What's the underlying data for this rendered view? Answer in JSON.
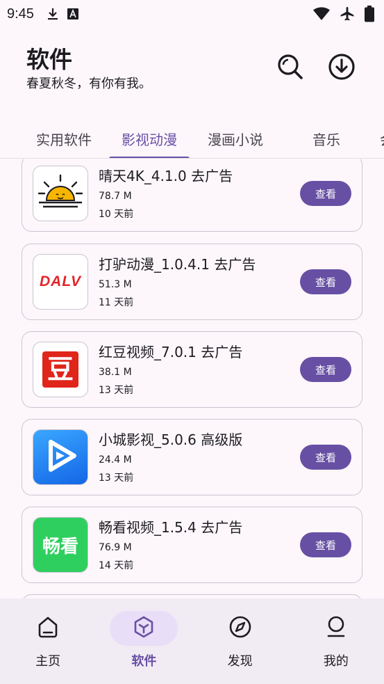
{
  "status_bar": {
    "time": "9:45"
  },
  "header": {
    "title": "软件",
    "subtitle": "春夏秋冬，有你有我。"
  },
  "tabs": [
    {
      "label": "实用软件",
      "active": false
    },
    {
      "label": "影视动漫",
      "active": true
    },
    {
      "label": "漫画小说",
      "active": false
    },
    {
      "label": "音乐",
      "active": false
    },
    {
      "label": "会员",
      "active": false
    }
  ],
  "apps": [
    {
      "name": "晴天4K_4.1.0 去广告",
      "size": "78.7 M",
      "time": "10 天前",
      "button": "查看",
      "icon": "sunrise-icon"
    },
    {
      "name": "打驴动漫_1.0.4.1 去广告",
      "size": "51.3 M",
      "time": "11 天前",
      "button": "查看",
      "icon": "dalv-logo-icon",
      "logo_text": "DALV"
    },
    {
      "name": "红豆视频_7.0.1 去广告",
      "size": "38.1 M",
      "time": "13 天前",
      "button": "查看",
      "icon": "hongdou-icon",
      "logo_text": "豆"
    },
    {
      "name": "小城影视_5.0.6 高级版",
      "size": "24.4 M",
      "time": "13 天前",
      "button": "查看",
      "icon": "play-icon"
    },
    {
      "name": "畅看视频_1.5.4 去广告",
      "size": "76.9 M",
      "time": "14 天前",
      "button": "查看",
      "icon": "changkan-icon",
      "logo_text": "畅看"
    }
  ],
  "bottom_nav": [
    {
      "label": "主页",
      "icon": "home-icon",
      "active": false
    },
    {
      "label": "软件",
      "icon": "cube-icon",
      "active": true
    },
    {
      "label": "发现",
      "icon": "compass-icon",
      "active": false
    },
    {
      "label": "我的",
      "icon": "person-icon",
      "active": false
    }
  ],
  "colors": {
    "accent": "#6750a4",
    "background": "#fdf7fc",
    "nav_bg": "#f1ebf4"
  }
}
